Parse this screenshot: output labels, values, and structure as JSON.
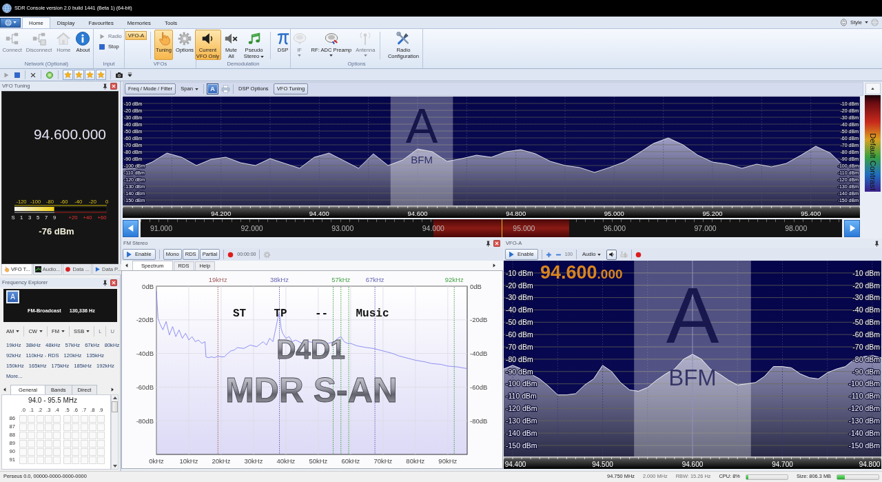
{
  "window": {
    "title": "SDR Console version 2.0 build 1441 (Beta 1) (64-bit)"
  },
  "ribbon": {
    "tabs": [
      {
        "label": "Home",
        "selected": true
      },
      {
        "label": "Display",
        "selected": false
      },
      {
        "label": "Favourites",
        "selected": false
      },
      {
        "label": "Memories",
        "selected": false
      },
      {
        "label": "Tools",
        "selected": false
      }
    ],
    "style_menu": "Style",
    "groups": [
      {
        "label": "Network (Optional)",
        "items": [
          {
            "kind": "large",
            "label": "Connect",
            "disabled": true
          },
          {
            "kind": "large",
            "label": "Disconnect",
            "disabled": true
          },
          {
            "kind": "large",
            "label": "Home",
            "disabled": true
          },
          {
            "kind": "large",
            "label": "About",
            "disabled": false
          }
        ]
      },
      {
        "label": "Input",
        "items": [
          {
            "kind": "small",
            "label": "Radio",
            "disabled": true
          },
          {
            "kind": "small",
            "label": "Stop",
            "disabled": false
          }
        ]
      },
      {
        "label": "VFOs",
        "items": [
          {
            "kind": "chip",
            "label": "VFO-A",
            "selected": true
          },
          {
            "kind": "large",
            "label": "Tuning",
            "selected": true
          },
          {
            "kind": "large",
            "label": "Options",
            "selected": false
          }
        ]
      },
      {
        "label": "Demodulation",
        "items": [
          {
            "kind": "large",
            "label": "Current VFO Only",
            "selected": true
          },
          {
            "kind": "large",
            "label": "Mute All",
            "selected": false
          },
          {
            "kind": "large",
            "label": "Pseudo Stereo",
            "dropdown": true
          },
          {
            "kind": "large",
            "label": "DSP"
          }
        ]
      },
      {
        "label": "Options",
        "items": [
          {
            "kind": "large",
            "label": "IF",
            "dropdown": true,
            "disabled": true
          },
          {
            "kind": "large",
            "label": "RF: ADC Preamp",
            "dropdown": true,
            "disabled": false
          },
          {
            "kind": "large",
            "label": "Antenna",
            "dropdown": true,
            "disabled": true
          },
          {
            "kind": "large",
            "label": "Radio Configuration"
          }
        ]
      }
    ]
  },
  "vfo_tuning": {
    "title": "VFO Tuning",
    "frequency": "94.600.000",
    "meter": {
      "top_scale": [
        "-120",
        "-100",
        "-80",
        "-60",
        "-40",
        "-20",
        "0"
      ],
      "s_scale": [
        "S",
        "1",
        "3",
        "5",
        "7",
        "9"
      ],
      "plus_scale": [
        "+20",
        "+40",
        "+60"
      ],
      "level": 0.43
    },
    "reading": "-76 dBm"
  },
  "dock_tabs": [
    {
      "label": "VFO T...",
      "selected": true
    },
    {
      "label": "Audio...",
      "selected": false
    },
    {
      "label": "Data ...",
      "selected": false
    },
    {
      "label": "Data P...",
      "selected": false
    }
  ],
  "frequency_explorer": {
    "title": "Frequency Explorer",
    "vfo_badge": "A",
    "band": "FM-Broadcast",
    "offset": "130,336 Hz",
    "modes": [
      {
        "label": "AM",
        "dropdown": true,
        "disabled": false
      },
      {
        "label": "CW",
        "dropdown": true,
        "disabled": false
      },
      {
        "label": "FM",
        "dropdown": true,
        "disabled": false
      },
      {
        "label": "SSB",
        "dropdown": true,
        "disabled": false
      },
      {
        "label": "L",
        "dropdown": false,
        "disabled": true
      },
      {
        "label": "U",
        "dropdown": false,
        "disabled": true
      }
    ],
    "link_rows": [
      [
        "19kHz",
        "38kHz",
        "48kHz",
        "57kHz",
        "67kHz",
        "80kHz"
      ],
      [
        "92kHz",
        "110kHz - RDS",
        "120kHz",
        "135kHz"
      ],
      [
        "150kHz",
        "165kHz",
        "175kHz",
        "185kHz",
        "192kHz"
      ],
      [
        "More..."
      ]
    ],
    "tabs": [
      {
        "label": "General",
        "selected": true
      },
      {
        "label": "Bands",
        "selected": false
      },
      {
        "label": "Direct",
        "selected": false
      }
    ],
    "grid": {
      "title": "94.0 - 95.5 MHz",
      "columns": [
        ".0",
        ".1",
        ".2",
        ".3",
        ".4",
        ".5",
        ".6",
        ".7",
        ".8",
        ".9"
      ],
      "rows": [
        "86",
        "87",
        "88",
        "89",
        "90",
        "91"
      ]
    }
  },
  "spectrum_panel": {
    "toolbar": {
      "freq_mode": {
        "label": "Freq / Mode / Filter",
        "selected": true
      },
      "span": "Span",
      "vfo_button": {
        "label": "A",
        "selected": true
      },
      "dsp_options": "DSP Options",
      "vfo_tuning": {
        "label": "VFO Tuning",
        "selected": true
      }
    },
    "chart_data": {
      "type": "area",
      "x": [
        94.0,
        94.03,
        94.06,
        94.09,
        94.12,
        94.15,
        94.18,
        94.21,
        94.24,
        94.27,
        94.3,
        94.33,
        94.36,
        94.39,
        94.42,
        94.45,
        94.48,
        94.51,
        94.54,
        94.57,
        94.6,
        94.63,
        94.66,
        94.69,
        94.72,
        94.75,
        94.78,
        94.81,
        94.84,
        94.87,
        94.9,
        94.93,
        94.96,
        94.99,
        95.02,
        95.05,
        95.08,
        95.11,
        95.14,
        95.17,
        95.2,
        95.23,
        95.26,
        95.29,
        95.32,
        95.35,
        95.38,
        95.41,
        95.44,
        95.47,
        95.5
      ],
      "series": [
        {
          "color": "#ffffff",
          "values": [
            -105,
            -104,
            -95,
            -82,
            -88,
            -100,
            -91,
            -88,
            -96,
            -100,
            -90,
            -97,
            -104,
            -88,
            -82,
            -93,
            -104,
            -83,
            -100,
            -92,
            -76,
            -80,
            -94,
            -90,
            -85,
            -88,
            -80,
            -77,
            -83,
            -94,
            -100,
            -103,
            -110,
            -103,
            -95,
            -82,
            -68,
            -60,
            -70,
            -85,
            -95,
            -98,
            -104,
            -98,
            -102,
            -97,
            -85,
            -72,
            -82,
            -103,
            -100
          ]
        }
      ],
      "xlim": [
        94.0,
        95.5
      ],
      "ylim": [
        -158,
        0
      ],
      "grid": true,
      "xticks": [
        {
          "value": 94.2,
          "label": "94.200"
        },
        {
          "value": 94.4,
          "label": "94.400"
        },
        {
          "value": 94.6,
          "label": "94.600"
        },
        {
          "value": 94.8,
          "label": "94.800"
        },
        {
          "value": 95.0,
          "label": "95.000"
        },
        {
          "value": 95.2,
          "label": "95.200"
        },
        {
          "value": 95.4,
          "label": "95.400"
        }
      ],
      "yticks": [
        {
          "value": -10,
          "label": "-10 dBm"
        },
        {
          "value": -20,
          "label": "-20 dBm"
        },
        {
          "value": -30,
          "label": "-30 dBm"
        },
        {
          "value": -40,
          "label": "-40 dBm"
        },
        {
          "value": -50,
          "label": "-50 dBm"
        },
        {
          "value": -60,
          "label": "-60 dBm"
        },
        {
          "value": -70,
          "label": "-70 dBm"
        },
        {
          "value": -80,
          "label": "-80 dBm"
        },
        {
          "value": -90,
          "label": "-90 dBm"
        },
        {
          "value": -100,
          "label": "-100 dBm"
        },
        {
          "value": -110,
          "label": "-110 dBm"
        },
        {
          "value": -120,
          "label": "-120 dBm"
        },
        {
          "value": -130,
          "label": "-130 dBm"
        },
        {
          "value": -140,
          "label": "-140 dBm"
        },
        {
          "value": -150,
          "label": "-150 dBm"
        }
      ],
      "bands": [
        {
          "axis": "x",
          "from": 94.545,
          "to": 94.672
        }
      ],
      "annotations": [
        "A",
        "BFM"
      ]
    },
    "right_axis_labels": [
      "-10 dBm",
      "-20 dBm",
      "-30 dBm",
      "-40 dBm",
      "-50 dBm",
      "-60 dBm",
      "-70 dBm",
      "-80 dBm",
      "-90 dBm",
      "-100 dBm",
      "-110 dBm",
      "-120 dBm",
      "-130 dBm",
      "-140 dBm",
      "-150 dBm"
    ],
    "band_scale": {
      "labels": [
        "91.000",
        "92.000",
        "93.000",
        "94.000",
        "95.000",
        "96.000",
        "97.000",
        "98.000"
      ]
    },
    "contrast_label": "Default Contrast"
  },
  "fm_stereo": {
    "title": "FM Stereo",
    "enable": "Enable",
    "buttons": [
      "Mono",
      "RDS",
      "Partial"
    ],
    "timer": "00:00:00",
    "tabs": [
      {
        "label": "Spectrum",
        "selected": true
      },
      {
        "label": "RDS",
        "selected": false
      },
      {
        "label": "Help",
        "selected": false
      }
    ],
    "chart_data": {
      "type": "line",
      "x": [
        0,
        0.5,
        1,
        2,
        3,
        4,
        5,
        6,
        7,
        8,
        9,
        10,
        11,
        12,
        13,
        14,
        15,
        15.3,
        16,
        17,
        18,
        19,
        20,
        21,
        22,
        23,
        24,
        25,
        27,
        29,
        31,
        33,
        34,
        35,
        36,
        37,
        37.5,
        38,
        38.5,
        39,
        40,
        41,
        42,
        43,
        45,
        47,
        50,
        53,
        55,
        56,
        57,
        58,
        59,
        60,
        62,
        65,
        67,
        70,
        73,
        75,
        78,
        80,
        83,
        85,
        88,
        90,
        93,
        96
      ],
      "series": [
        {
          "color": "#8484f0",
          "values": [
            -3,
            -19,
            -22,
            -26,
            -21,
            -29,
            -24,
            -30,
            -26,
            -31,
            -28,
            -32,
            -30,
            -33,
            -32,
            -34,
            -33,
            -42,
            -42.5,
            -42,
            -42.5,
            -41.5,
            -42,
            -42,
            -40,
            -38.5,
            -38,
            -36.5,
            -37,
            -35,
            -36,
            -33,
            -35,
            -31,
            -33,
            -24,
            -19,
            -16,
            -25,
            -28,
            -31,
            -30,
            -33,
            -32,
            -34,
            -33,
            -34,
            -34,
            -33,
            -31,
            -30,
            -33,
            -34,
            -34,
            -35.5,
            -36.5,
            -37,
            -38.5,
            -40,
            -41.5,
            -43,
            -44,
            -45,
            -46,
            -46.5,
            -47.5,
            -48,
            -49
          ]
        }
      ],
      "xlim": [
        0,
        96
      ],
      "ylim": [
        -100,
        0
      ],
      "grid": true,
      "xticks": [
        {
          "value": 0,
          "label": "0kHz"
        },
        {
          "value": 10,
          "label": "10kHz"
        },
        {
          "value": 20,
          "label": "20kHz"
        },
        {
          "value": 30,
          "label": "30kHz"
        },
        {
          "value": 40,
          "label": "40kHz"
        },
        {
          "value": 50,
          "label": "50kHz"
        },
        {
          "value": 60,
          "label": "60kHz"
        },
        {
          "value": 70,
          "label": "70kHz"
        },
        {
          "value": 80,
          "label": "80kHz"
        },
        {
          "value": 90,
          "label": "90kHz"
        }
      ],
      "yticks": [
        {
          "value": 0,
          "label": "0dB"
        },
        {
          "value": -20,
          "label": "-20dB"
        },
        {
          "value": -40,
          "label": "-40dB"
        },
        {
          "value": -60,
          "label": "-60dB"
        },
        {
          "value": -80,
          "label": "-80dB"
        }
      ],
      "ref_lines": [
        {
          "axis": "x",
          "value": 19,
          "label": "19kHz",
          "color": "#a05a5a"
        },
        {
          "axis": "x",
          "value": 38,
          "label": "38kHz",
          "color": "#6464b4"
        },
        {
          "axis": "x",
          "value": 54.6,
          "color": "#44a044"
        },
        {
          "axis": "x",
          "value": 57,
          "label": "57kHz",
          "color": "#44a044"
        },
        {
          "axis": "x",
          "value": 59.4,
          "color": "#44a044"
        },
        {
          "axis": "x",
          "value": 67.5,
          "label": "67kHz",
          "color": "#6464b4"
        },
        {
          "axis": "x",
          "value": 92,
          "label": "92kHz",
          "color": "#44a044"
        }
      ]
    },
    "right_axis_labels": [
      "0dB",
      "-20dB",
      "-40dB",
      "-60dB",
      "-80dB"
    ],
    "rds": {
      "flags": [
        "ST",
        "TP",
        "--",
        "Music"
      ],
      "pi_code": "D4D1",
      "station_name": "MDR S-AN"
    }
  },
  "vfo_a": {
    "title": "VFO-A",
    "enable": "Enable",
    "step": "100",
    "audio": "Audio",
    "frequency_main": "94.600",
    "frequency_fine": ".000",
    "chart_data": {
      "type": "area",
      "x": [
        94.39,
        94.4,
        94.41,
        94.42,
        94.43,
        94.44,
        94.45,
        94.46,
        94.47,
        94.48,
        94.49,
        94.5,
        94.51,
        94.52,
        94.53,
        94.54,
        94.55,
        94.56,
        94.57,
        94.58,
        94.59,
        94.6,
        94.61,
        94.62,
        94.63,
        94.64,
        94.65,
        94.66,
        94.67,
        94.68,
        94.69,
        94.7,
        94.71,
        94.72,
        94.73,
        94.74,
        94.75,
        94.76,
        94.77,
        94.78,
        94.79,
        94.8,
        94.81
      ],
      "series": [
        {
          "color": "#ffffff",
          "values": [
            -88,
            -85,
            -88,
            -92,
            -96,
            -102,
            -109,
            -109,
            -108,
            -101,
            -96,
            -85,
            -90,
            -99,
            -105,
            -106,
            -103,
            -97,
            -92,
            -88,
            -80,
            -76,
            -80,
            -88,
            -92,
            -97,
            -101,
            -100,
            -99,
            -94,
            -86,
            -86,
            -87,
            -92,
            -95,
            -96,
            -91,
            -88,
            -86,
            -80,
            -78,
            -77,
            -79
          ]
        }
      ],
      "xlim": [
        94.39,
        94.81
      ],
      "ylim": [
        -159,
        0
      ],
      "grid": true,
      "xticks": [
        {
          "value": 94.4,
          "label": "94.400"
        },
        {
          "value": 94.5,
          "label": "94.500"
        },
        {
          "value": 94.6,
          "label": "94.600"
        },
        {
          "value": 94.7,
          "label": "94.700"
        },
        {
          "value": 94.8,
          "label": "94.800"
        }
      ],
      "yticks": [
        {
          "value": -10,
          "label": "-10 dBm"
        },
        {
          "value": -20,
          "label": "-20 dBm"
        },
        {
          "value": -30,
          "label": "-30 dBm"
        },
        {
          "value": -40,
          "label": "-40 dBm"
        },
        {
          "value": -50,
          "label": "-50 dBm"
        },
        {
          "value": -60,
          "label": "-60 dBm"
        },
        {
          "value": -70,
          "label": "-70 dBm"
        },
        {
          "value": -80,
          "label": "-80 dBm"
        },
        {
          "value": -90,
          "label": "-90 dBm"
        },
        {
          "value": -100,
          "label": "-100 dBm"
        },
        {
          "value": -110,
          "label": "-110 dBm"
        },
        {
          "value": -120,
          "label": "-120 dBm"
        },
        {
          "value": -130,
          "label": "-130 dBm"
        },
        {
          "value": -140,
          "label": "-140 dBm"
        },
        {
          "value": -150,
          "label": "-150 dBm"
        }
      ],
      "bands": [
        {
          "axis": "x",
          "from": 94.535,
          "to": 94.665
        }
      ],
      "ref_lines": [
        {
          "axis": "x",
          "value": 94.6
        }
      ],
      "annotations": [
        "A",
        "BFM"
      ]
    },
    "right_axis_labels": [
      "-10 dBm",
      "-20 dBm",
      "-30 dBm",
      "-40 dBm",
      "-50 dBm",
      "-60 dBm",
      "-70 dBm",
      "-80 dBm",
      "-90 dBm",
      "-100 dBm",
      "-110 dBm",
      "-120 dBm",
      "-130 dBm",
      "-140 dBm",
      "-150 dBm"
    ]
  },
  "status": {
    "device": "Perseus 0.0, 00000-0000-0000-0000",
    "items": [
      {
        "kind": "text",
        "label": "94.750 MHz",
        "disabled": false
      },
      {
        "kind": "text",
        "label": "2.000 MHz",
        "disabled": true
      },
      {
        "kind": "text",
        "label": "RBW: 15.26 Hz",
        "disabled": true
      },
      {
        "kind": "meter",
        "label": "CPU: 8%",
        "disabled": false,
        "level": 0.06
      },
      {
        "kind": "meter",
        "label": "Size: 806.3 MB",
        "disabled": false,
        "level": 0.18
      }
    ]
  }
}
